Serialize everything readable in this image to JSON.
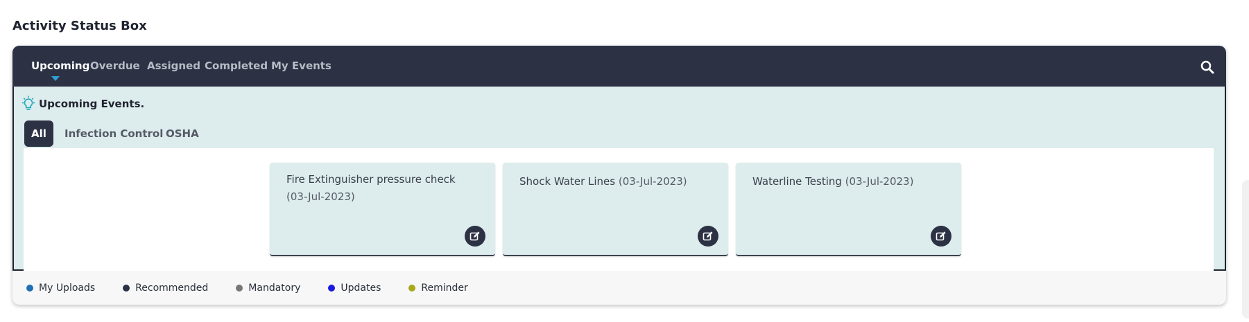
{
  "page_title": "Activity Status Box",
  "tabs": [
    {
      "label": "Upcoming",
      "active": true
    },
    {
      "label": "Overdue",
      "active": false
    },
    {
      "label": "Assigned",
      "active": false
    },
    {
      "label": "Completed",
      "active": false
    },
    {
      "label": "My Events",
      "active": false
    }
  ],
  "search_icon": "search-icon",
  "panel": {
    "heading_icon": "lightbulb-icon",
    "heading": "Upcoming Events.",
    "subtabs": [
      {
        "label": "All",
        "active": true
      },
      {
        "label": "Infection Control",
        "active": false
      },
      {
        "label": "OSHA",
        "active": false
      }
    ],
    "events": [
      {
        "title": "Fire Extinguisher pressure check",
        "date": "(03-Jul-2023)",
        "edit_icon": "edit-icon"
      },
      {
        "title": "Shock Water Lines",
        "date": "(03-Jul-2023)",
        "edit_icon": "edit-icon"
      },
      {
        "title": "Waterline Testing",
        "date": "(03-Jul-2023)",
        "edit_icon": "edit-icon"
      }
    ]
  },
  "legend": [
    {
      "label": "My Uploads",
      "color": "#1f6fb5"
    },
    {
      "label": "Recommended",
      "color": "#2c3244"
    },
    {
      "label": "Mandatory",
      "color": "#777777"
    },
    {
      "label": "Updates",
      "color": "#1a1ae0"
    },
    {
      "label": "Reminder",
      "color": "#a8a81a"
    }
  ],
  "colors": {
    "navbar": "#2c3244",
    "panel_bg": "#ddecec",
    "active_caret": "#2f9fd6"
  }
}
